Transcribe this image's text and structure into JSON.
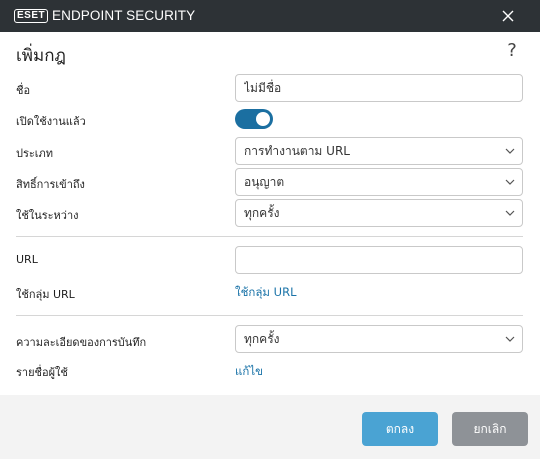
{
  "titlebar": {
    "logo": "ESET",
    "product": "ENDPOINT SECURITY"
  },
  "dialog": {
    "title": "เพิ่มกฎ",
    "help": "?"
  },
  "form": {
    "name_label": "ชื่อ",
    "name_value": "ไม่มีชื่อ",
    "enabled_label": "เปิดใช้งานแล้ว",
    "enabled": true,
    "type_label": "ประเภท",
    "type_value": "การทำงานตาม URL",
    "access_label": "สิทธิ์การเข้าถึง",
    "access_value": "อนุญาต",
    "during_label": "ใช้ในระหว่าง",
    "during_value": "ทุกครั้ง",
    "url_label": "URL",
    "url_value": "",
    "url_group_label": "ใช้กลุ่ม URL",
    "url_group_link": "ใช้กลุ่ม URL",
    "log_label": "ความละเอียดของการบันทึก",
    "log_value": "ทุกครั้ง",
    "users_label": "รายชื่อผู้ใช้",
    "users_link": "แก้ไข"
  },
  "footer": {
    "ok": "ตกลง",
    "cancel": "ยกเลิก"
  },
  "colors": {
    "titlebar": "#2d3236",
    "accent": "#1b6fa1",
    "link": "#1a73a8",
    "ok_button": "#4aa3d3",
    "cancel_button": "#8e9297"
  }
}
